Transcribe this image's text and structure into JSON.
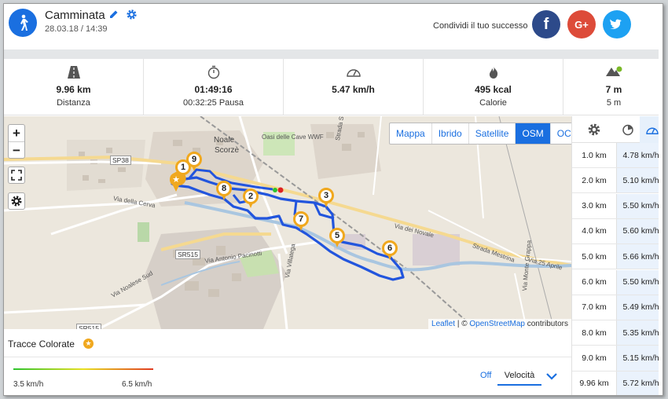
{
  "header": {
    "title": "Camminata",
    "date": "28.03.18 / 14:39",
    "share_text": "Condividi il tuo successo",
    "social": [
      "f",
      "G+",
      "twitter"
    ]
  },
  "stats": [
    {
      "value": "9.96 km",
      "label": "Distanza",
      "icon": "road-icon"
    },
    {
      "value": "01:49:16",
      "label": "00:32:25 Pausa",
      "icon": "stopwatch-icon"
    },
    {
      "value": "5.47 km/h",
      "label": "",
      "icon": "speedometer-icon"
    },
    {
      "value": "495 kcal",
      "label": "Calorie",
      "icon": "flame-icon"
    },
    {
      "value": "7 m",
      "label": "5 m",
      "icon": "elevation-icon"
    }
  ],
  "map": {
    "layers": [
      {
        "label": "Mappa",
        "active": false
      },
      {
        "label": "Ibrido",
        "active": false
      },
      {
        "label": "Satellite",
        "active": false
      },
      {
        "label": "OSM",
        "active": true
      },
      {
        "label": "OCM",
        "active": false
      }
    ],
    "zoom_in": "+",
    "zoom_out": "−",
    "attribution": {
      "leaflet": "Leaflet",
      "sep": " | © ",
      "osm": "OpenStreetMap",
      "rest": " contributors"
    },
    "place_labels": [
      "Noale",
      "Scorzè",
      "Oasi delle Cave WWF",
      "SP38",
      "SR515",
      "SR515",
      "Via della Cerva",
      "Via Antonio Pacinotti",
      "Via dei Novale",
      "Strada Mestrina",
      "Via 25 Aprile",
      "Via Noalese Sud",
      "Via Villatega",
      "Strada Scorzè",
      "Via Monte Grappa"
    ],
    "markers": [
      "1",
      "2",
      "3",
      "5",
      "6",
      "7",
      "8",
      "9"
    ]
  },
  "colored_tracks": {
    "label": "Tracce Colorate",
    "min_speed": "3.5 km/h",
    "max_speed": "6.5 km/h",
    "off_label": "Off",
    "selected": "Velocità"
  },
  "splits": [
    {
      "distance": "1.0 km",
      "speed": "4.78 km/h"
    },
    {
      "distance": "2.0 km",
      "speed": "5.10 km/h"
    },
    {
      "distance": "3.0 km",
      "speed": "5.50 km/h"
    },
    {
      "distance": "4.0 km",
      "speed": "5.60 km/h"
    },
    {
      "distance": "5.0 km",
      "speed": "5.66 km/h"
    },
    {
      "distance": "6.0 km",
      "speed": "5.50 km/h"
    },
    {
      "distance": "7.0 km",
      "speed": "5.49 km/h"
    },
    {
      "distance": "8.0 km",
      "speed": "5.35 km/h"
    },
    {
      "distance": "9.0 km",
      "speed": "5.15 km/h"
    },
    {
      "distance": "9.96 km",
      "speed": "5.72 km/h"
    }
  ],
  "colors": {
    "accent": "#1a6fe0",
    "route": "#2255dd",
    "marker": "#f0a81e"
  }
}
